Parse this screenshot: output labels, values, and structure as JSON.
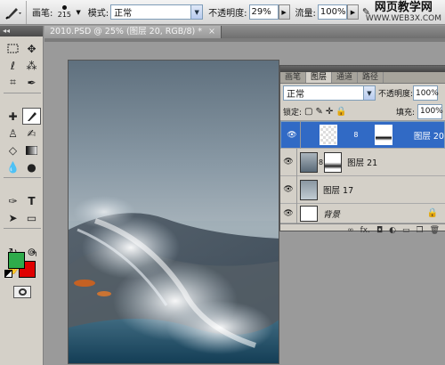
{
  "options_bar": {
    "tool_icon": "brush-icon",
    "brush_label": "画笔:",
    "brush_size": "215",
    "mode_label": "模式:",
    "mode_value": "正常",
    "opacity_label": "不透明度:",
    "opacity_value": "29%",
    "flow_label": "流量:",
    "flow_value": "100%"
  },
  "watermark": {
    "line1": "网页教学网",
    "line2": "WWW.WEB3X.COM"
  },
  "document": {
    "tab_title": "2010.PSD @ 25% (图层 20, RGB/8) *",
    "close_glyph": "×"
  },
  "colors": {
    "foreground": "#2eab4b",
    "background": "#e00000"
  },
  "layers_panel": {
    "tabs": [
      {
        "label": "画笔",
        "active": false
      },
      {
        "label": "图层",
        "active": true
      },
      {
        "label": "通道",
        "active": false
      },
      {
        "label": "路径",
        "active": false
      }
    ],
    "blend_mode": "正常",
    "opacity_label": "不透明度:",
    "opacity_value": "100%",
    "lock_label": "锁定:",
    "fill_label": "填充:",
    "fill_value": "100%",
    "layers": [
      {
        "name": "图层 20",
        "selected": true
      },
      {
        "name": "图层 21",
        "selected": false
      },
      {
        "name": "图层 17",
        "selected": false
      },
      {
        "name": "背景",
        "selected": false
      }
    ],
    "bottom_icons": [
      "link-icon",
      "fx-icon",
      "mask-icon",
      "adjustment-icon",
      "folder-icon",
      "new-layer-icon",
      "trash-icon"
    ],
    "fx_label": "fx."
  }
}
